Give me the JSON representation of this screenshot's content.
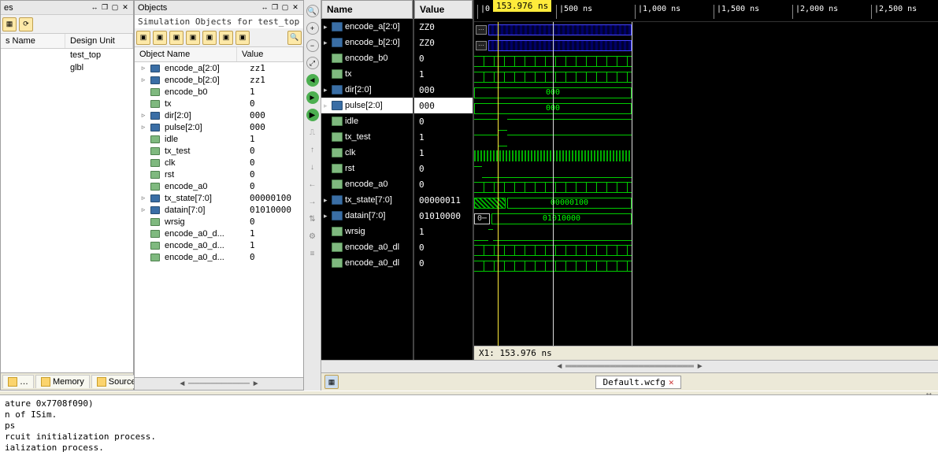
{
  "left_panel": {
    "col1": "s Name",
    "col2": "Design Unit",
    "rows": [
      {
        "name": "",
        "unit": "test_top"
      },
      {
        "name": "",
        "unit": "glbl"
      }
    ]
  },
  "objects_panel": {
    "title": "Objects",
    "subtitle": "Simulation Objects for test_top",
    "col_name": "Object Name",
    "col_value": "Value",
    "rows": [
      {
        "exp": "▹",
        "type": "bus",
        "name": "encode_a[2:0]",
        "val": "zz1"
      },
      {
        "exp": "▹",
        "type": "bus",
        "name": "encode_b[2:0]",
        "val": "zz1"
      },
      {
        "exp": "",
        "type": "wire",
        "name": "encode_b0",
        "val": "1"
      },
      {
        "exp": "",
        "type": "wire",
        "name": "tx",
        "val": "0"
      },
      {
        "exp": "▹",
        "type": "bus",
        "name": "dir[2:0]",
        "val": "000"
      },
      {
        "exp": "▹",
        "type": "bus",
        "name": "pulse[2:0]",
        "val": "000"
      },
      {
        "exp": "",
        "type": "wire",
        "name": "idle",
        "val": "1"
      },
      {
        "exp": "",
        "type": "wire",
        "name": "tx_test",
        "val": "0"
      },
      {
        "exp": "",
        "type": "wire",
        "name": "clk",
        "val": "0"
      },
      {
        "exp": "",
        "type": "wire",
        "name": "rst",
        "val": "0"
      },
      {
        "exp": "",
        "type": "wire",
        "name": "encode_a0",
        "val": "0"
      },
      {
        "exp": "▹",
        "type": "bus",
        "name": "tx_state[7:0]",
        "val": "00000100"
      },
      {
        "exp": "▹",
        "type": "bus",
        "name": "datain[7:0]",
        "val": "01010000"
      },
      {
        "exp": "",
        "type": "wire",
        "name": "wrsig",
        "val": "0"
      },
      {
        "exp": "",
        "type": "wire",
        "name": "encode_a0_d...",
        "val": "1"
      },
      {
        "exp": "",
        "type": "wire",
        "name": "encode_a0_d...",
        "val": "1"
      },
      {
        "exp": "",
        "type": "wire",
        "name": "encode_a0_d...",
        "val": "0"
      }
    ]
  },
  "bottom_tabs": {
    "memory": "Memory",
    "source": "Source",
    "more": "…"
  },
  "waveform": {
    "cursor_label": "153.976 ns",
    "status": "X1: 153.976 ns",
    "file_tab": "Default.wcfg",
    "col_name": "Name",
    "col_value": "Value",
    "ticks": [
      {
        "pos": 0,
        "label": "0 ns"
      },
      {
        "pos": 100,
        "label": "500 ns"
      },
      {
        "pos": 200,
        "label": "1,000 ns"
      },
      {
        "pos": 300,
        "label": "1,500 ns"
      },
      {
        "pos": 400,
        "label": "2,000 ns"
      },
      {
        "pos": 500,
        "label": "2,500 ns"
      }
    ],
    "rows": [
      {
        "exp": "▸",
        "type": "bus",
        "name": "encode_a[2:0]",
        "val": "ZZ0",
        "sel": false
      },
      {
        "exp": "▸",
        "type": "bus",
        "name": "encode_b[2:0]",
        "val": "ZZ0",
        "sel": false
      },
      {
        "exp": "",
        "type": "wire",
        "name": "encode_b0",
        "val": "0",
        "sel": false
      },
      {
        "exp": "",
        "type": "wire",
        "name": "tx",
        "val": "1",
        "sel": false
      },
      {
        "exp": "▸",
        "type": "bus",
        "name": "dir[2:0]",
        "val": "000",
        "sel": false
      },
      {
        "exp": "▸",
        "type": "bus",
        "name": "pulse[2:0]",
        "val": "000",
        "sel": true
      },
      {
        "exp": "",
        "type": "wire",
        "name": "idle",
        "val": "0",
        "sel": false
      },
      {
        "exp": "",
        "type": "wire",
        "name": "tx_test",
        "val": "1",
        "sel": false
      },
      {
        "exp": "",
        "type": "wire",
        "name": "clk",
        "val": "1",
        "sel": false
      },
      {
        "exp": "",
        "type": "wire",
        "name": "rst",
        "val": "0",
        "sel": false
      },
      {
        "exp": "",
        "type": "wire",
        "name": "encode_a0",
        "val": "0",
        "sel": false
      },
      {
        "exp": "▸",
        "type": "bus",
        "name": "tx_state[7:0]",
        "val": "00000011",
        "sel": false
      },
      {
        "exp": "▸",
        "type": "bus",
        "name": "datain[7:0]",
        "val": "01010000",
        "sel": false
      },
      {
        "exp": "",
        "type": "wire",
        "name": "wrsig",
        "val": "1",
        "sel": false
      },
      {
        "exp": "",
        "type": "wire",
        "name": "encode_a0_dl",
        "val": "0",
        "sel": false
      },
      {
        "exp": "",
        "type": "wire",
        "name": "encode_a0_dl",
        "val": "0",
        "sel": false
      }
    ],
    "bus_labels": {
      "dir": "000",
      "pulse": "000",
      "tx_state": "00000100",
      "datain": "01010000"
    }
  },
  "console_lines": "ature 0x7708f090)\nn of ISim.\nps\nrcuit initialization process.\nialization process."
}
